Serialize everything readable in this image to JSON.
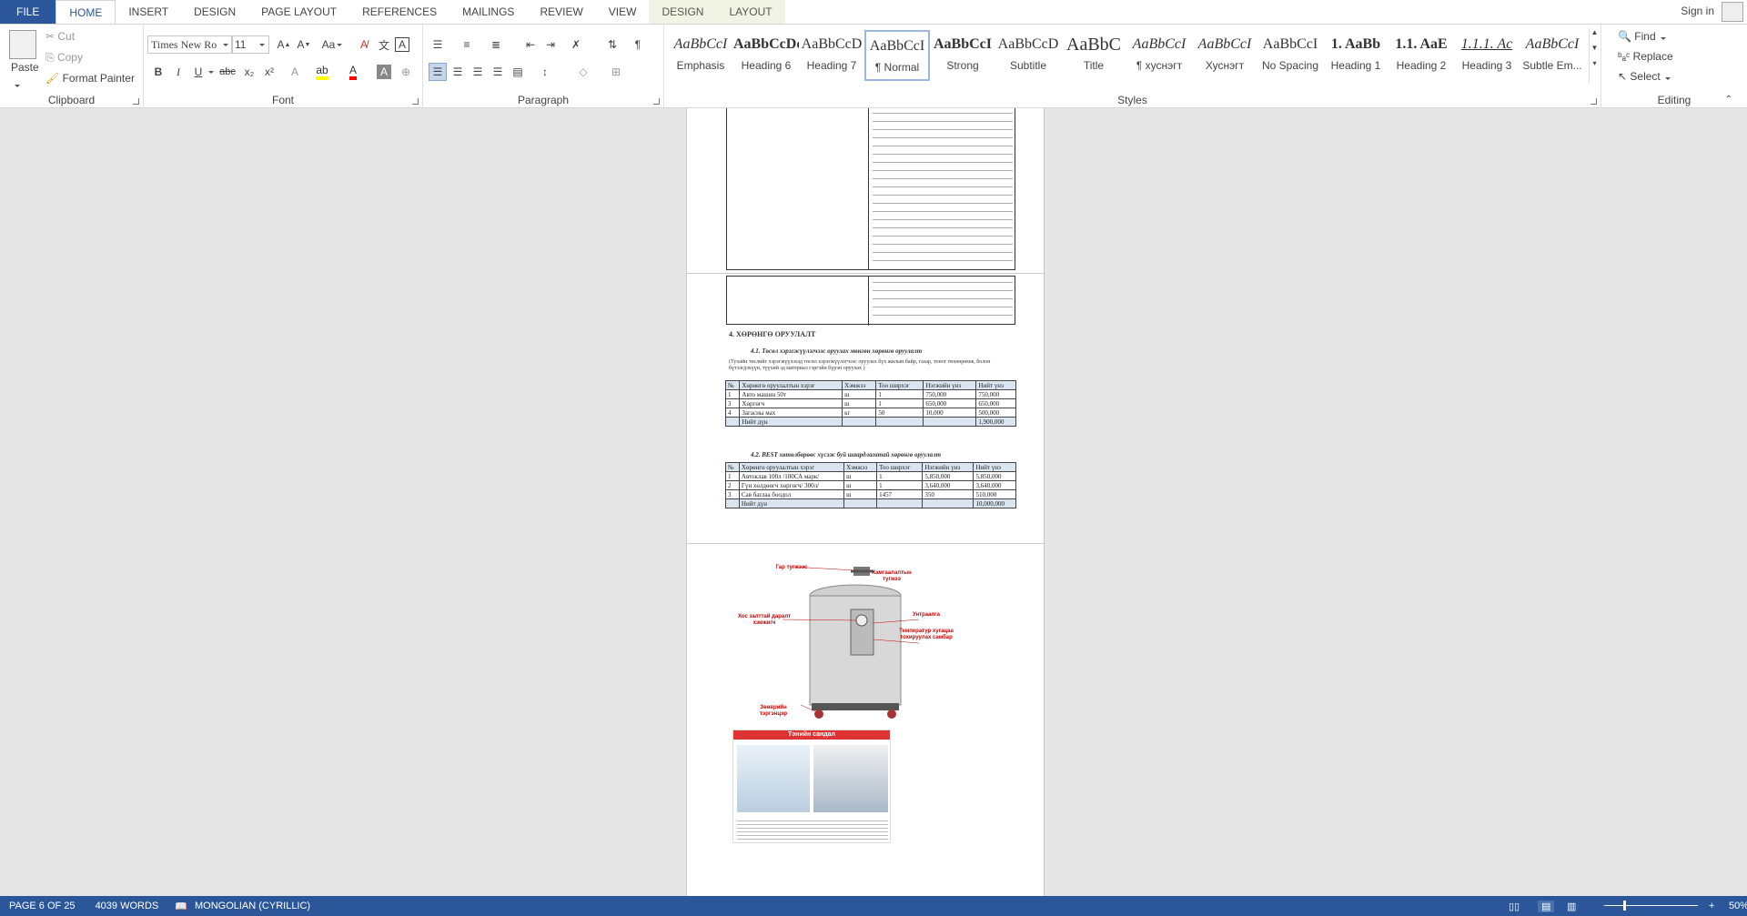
{
  "tabs": {
    "file": "FILE",
    "home": "HOME",
    "insert": "INSERT",
    "design": "DESIGN",
    "page_layout": "PAGE LAYOUT",
    "references": "REFERENCES",
    "mailings": "MAILINGS",
    "review": "REVIEW",
    "view": "VIEW",
    "ctx_design": "DESIGN",
    "ctx_layout": "LAYOUT"
  },
  "account": {
    "sign_in": "Sign in"
  },
  "clipboard": {
    "paste": "Paste",
    "cut": "Cut",
    "copy": "Copy",
    "format_painter": "Format Painter",
    "label": "Clipboard"
  },
  "font": {
    "name": "Times New Ro",
    "size": "11",
    "label": "Font",
    "change_case": "Aa",
    "bold": "B",
    "italic": "I",
    "underline": "U",
    "strike": "abc",
    "sub": "x₂",
    "sup": "x²"
  },
  "paragraph": {
    "label": "Paragraph"
  },
  "styles": {
    "label": "Styles",
    "items": [
      {
        "preview": "AaBbCcI",
        "name": "Emphasis"
      },
      {
        "preview": "AaBbCcDd",
        "name": "Heading 6"
      },
      {
        "preview": "AaBbCcD",
        "name": "Heading 7"
      },
      {
        "preview": "AaBbCcI",
        "name": "¶ Normal"
      },
      {
        "preview": "AaBbCcI",
        "name": "Strong"
      },
      {
        "preview": "AaBbCcD",
        "name": "Subtitle"
      },
      {
        "preview": "AaBbC",
        "name": "Title"
      },
      {
        "preview": "AaBbCcI",
        "name": "¶ хуснэгт"
      },
      {
        "preview": "AaBbCcI",
        "name": "Хуснэгт"
      },
      {
        "preview": "AaBbCcI",
        "name": "No Spacing"
      },
      {
        "preview": "1. AaBb",
        "name": "Heading 1"
      },
      {
        "preview": "1.1. AaE",
        "name": "Heading 2"
      },
      {
        "preview": "1.1.1. Ac",
        "name": "Heading 3"
      },
      {
        "preview": "AaBbCcI",
        "name": "Subtle Em..."
      }
    ]
  },
  "editing": {
    "label": "Editing",
    "find": "Find",
    "replace": "Replace",
    "select": "Select"
  },
  "document": {
    "section_heading": "4.  ХӨРӨНГӨ ОРУУЛАЛТ",
    "sub1": "4.1.      Төсөл хэрэгжүүлэгчээс оруулах мөнгөн хөрөнгө оруулалт",
    "sub1_note": "(Тухайн төслийг хэрэгжүүлэхэд төсөл хэрэгжүүлэгчээс оруулах бүх жилын байр, газар, тоног төхөөрөмж, болон бүтээгдэхүүн, түүхий эд материал гэргэйн бүрэн оруулах )",
    "table1": {
      "headers": [
        "№",
        "Хөрөнгө оруулалтын хэрэг",
        "Хэмжээ",
        "Тоо ширхэг",
        "Нэгжийн үнэ",
        "Нийт үнэ"
      ],
      "rows": [
        [
          "1",
          "Авто машин 50т",
          "ш",
          "1",
          "750,000",
          "750,000"
        ],
        [
          "3",
          "Хөргөгч",
          "ш",
          "1",
          "650,000",
          "650,000"
        ],
        [
          "4",
          "Загасны мах",
          "кг",
          "50",
          "10,000",
          "500,000"
        ],
        [
          "",
          "Нийт дүн",
          "",
          "",
          "",
          "1,900,000"
        ]
      ]
    },
    "sub2": "4.2.      BEST хөтөлбөрөөс хүсэж буй шаардлагатай хөрөнгө оруулалт",
    "table2": {
      "headers": [
        "№",
        "Хөрөнгө оруулалтын хэрэг",
        "Хэмжээ",
        "Тоо ширхэг",
        "Нэгжийн үнэ",
        "Нийт үнэ"
      ],
      "rows": [
        [
          "1",
          "Автоклав 100л /100СА марк/",
          "ш",
          "1",
          "5,850,000",
          "5,850,000"
        ],
        [
          "2",
          "Гүн хөлдөөгч хөргөгч/ 300л/",
          "ш",
          "1",
          "3,640,000",
          "3,640,000"
        ],
        [
          "3",
          "Сав баглаа боодол",
          "ш",
          "1457",
          "350",
          "510,000"
        ],
        [
          "",
          "Нийт дүн",
          "",
          "",
          "",
          "10,000,000"
        ]
      ]
    },
    "figure_labels": [
      "Гар тугжээс",
      "Хамгаалалтын тугжээ",
      "Хос залттай даралт хэмжигч",
      "Унтраалга",
      "Температур хугацаа тохируулах самбар",
      "Зөөврийн тэргэнцэр"
    ],
    "freezer_title": "Тэнийн сандал"
  },
  "status": {
    "page": "PAGE 6 OF 25",
    "words": "4039 WORDS",
    "language": "MONGOLIAN (CYRILLIC)",
    "zoom": "50%"
  }
}
